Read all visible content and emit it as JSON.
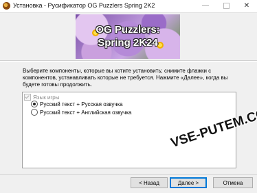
{
  "window": {
    "title": "Установка - Русификатор OG Puzzlers Spring 2K2",
    "minimize_glyph": "—",
    "close_glyph": "✕"
  },
  "banner": {
    "line1": "OG Puzzlers:",
    "line2": "Spring 2K24"
  },
  "description": "Выберите компоненты, которые вы хотите установить; снимите флажки с компонентов, устанавливать которые не требуется. Нажмите «Далее», когда вы будете готовы продолжить.",
  "components": {
    "group_label": "Язык игры",
    "group_checked": true,
    "options": [
      {
        "label": "Русский текст + Русская озвучка",
        "selected": true
      },
      {
        "label": "Русский текст + Английская озвучка",
        "selected": false
      }
    ]
  },
  "watermark": "VSE-PUTEM.COM",
  "buttons": {
    "back": "< Назад",
    "next": "Далее >",
    "cancel": "Отмена"
  },
  "icons": {
    "app": "installer-app-icon",
    "radio": "radio-icon",
    "checkbox": "checkbox-icon"
  }
}
